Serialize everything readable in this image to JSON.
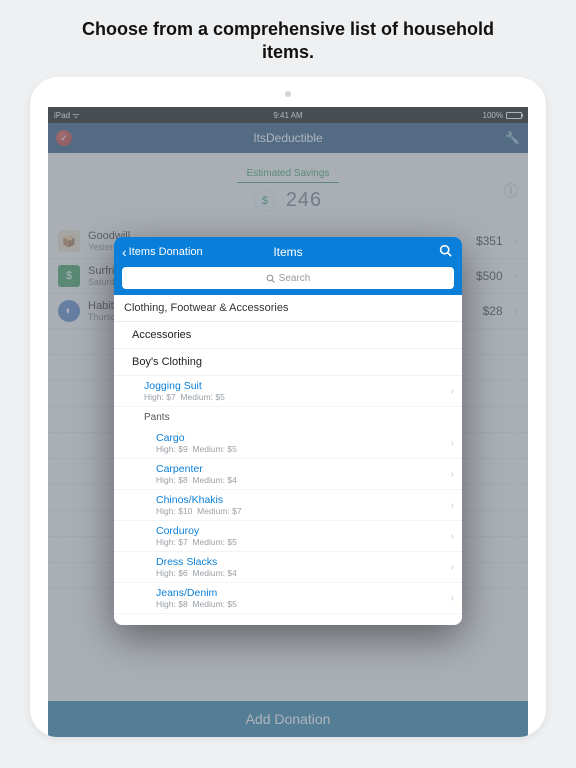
{
  "tagline": "Choose from a comprehensive list of household items.",
  "status": {
    "left": "iPad ᯤ",
    "center": "9:41 AM",
    "right_pct": "100%"
  },
  "nav": {
    "title": "ItsDeductible"
  },
  "savings": {
    "label": "Estimated Savings",
    "currency": "$",
    "value": "246"
  },
  "donations": [
    {
      "name": "Goodwill",
      "date": "Yesterday",
      "amount": "$351",
      "icon": "box"
    },
    {
      "name": "Surfrider Foundation",
      "date": "Saturday",
      "amount": "$500",
      "icon": "green"
    },
    {
      "name": "Habitat for Humanity",
      "date": "Thursday",
      "amount": "$28",
      "icon": "blue"
    }
  ],
  "footer_button": "Add Donation",
  "modal": {
    "back_label": "Items Donation",
    "title": "Items",
    "search_placeholder": "Search",
    "category": "Clothing, Footwear & Accessories",
    "subcats": [
      "Accessories",
      "Boy's Clothing"
    ],
    "items_group1": [
      {
        "name": "Jogging Suit",
        "high": "$7",
        "medium": "$5"
      }
    ],
    "group_label": "Pants",
    "items_group2": [
      {
        "name": "Cargo",
        "high": "$9",
        "medium": "$5"
      },
      {
        "name": "Carpenter",
        "high": "$8",
        "medium": "$4"
      },
      {
        "name": "Chinos/Khakis",
        "high": "$10",
        "medium": "$7"
      },
      {
        "name": "Corduroy",
        "high": "$7",
        "medium": "$5"
      },
      {
        "name": "Dress Slacks",
        "high": "$6",
        "medium": "$4"
      },
      {
        "name": "Jeans/Denim",
        "high": "$8",
        "medium": "$5"
      }
    ]
  },
  "labels": {
    "high": "High:",
    "medium": "Medium:"
  }
}
